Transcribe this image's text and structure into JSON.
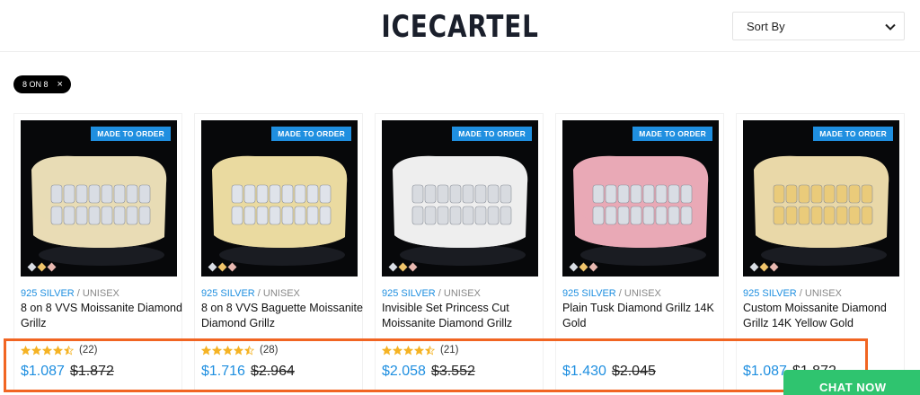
{
  "header": {
    "logo": "ICECARTEL",
    "sort_label": "Sort By"
  },
  "filter_chip": {
    "label": "8 ON 8",
    "close": "×"
  },
  "badge_label": "MADE TO ORDER",
  "category_separator": "/",
  "products": [
    {
      "category": "925 SILVER",
      "gender": "UNISEX",
      "name": "8 on 8 VVS Moissanite Diamond Grillz",
      "rating": 4.5,
      "reviews": "(22)",
      "price": "$1.087",
      "old_price": "$1.872",
      "gum_color": "#e8dcb5",
      "metal_color": "#d9dde4"
    },
    {
      "category": "925 SILVER",
      "gender": "UNISEX",
      "name": "8 on 8 VVS Baguette Moissanite Diamond Grillz",
      "rating": 4.5,
      "reviews": "(28)",
      "price": "$1.716",
      "old_price": "$2.964",
      "gum_color": "#eadaa0",
      "metal_color": "#dfe3ea"
    },
    {
      "category": "925 SILVER",
      "gender": "UNISEX",
      "name": "Invisible Set Princess Cut Moissanite Diamond Grillz",
      "rating": 4.5,
      "reviews": "(21)",
      "price": "$2.058",
      "old_price": "$3.552",
      "gum_color": "#eeeeee",
      "metal_color": "#d8dbe0"
    },
    {
      "category": "925 SILVER",
      "gender": "UNISEX",
      "name": "Plain Tusk Diamond Grillz 14K Gold",
      "rating": null,
      "reviews": "",
      "price": "$1.430",
      "old_price": "$2.045",
      "gum_color": "#e9a9b6",
      "metal_color": "#d9dde4"
    },
    {
      "category": "925 SILVER",
      "gender": "UNISEX",
      "name": "Custom Moissanite Diamond Grillz 14K Yellow Gold",
      "rating": null,
      "reviews": "",
      "price": "$1.087",
      "old_price": "$1.872",
      "gum_color": "#e9d8a8",
      "metal_color": "#eacb7a"
    }
  ],
  "chat": {
    "label": "CHAT NOW"
  },
  "colors": {
    "accent": "#1f8fe0",
    "highlight": "#f16522",
    "chat": "#2fc46f"
  }
}
